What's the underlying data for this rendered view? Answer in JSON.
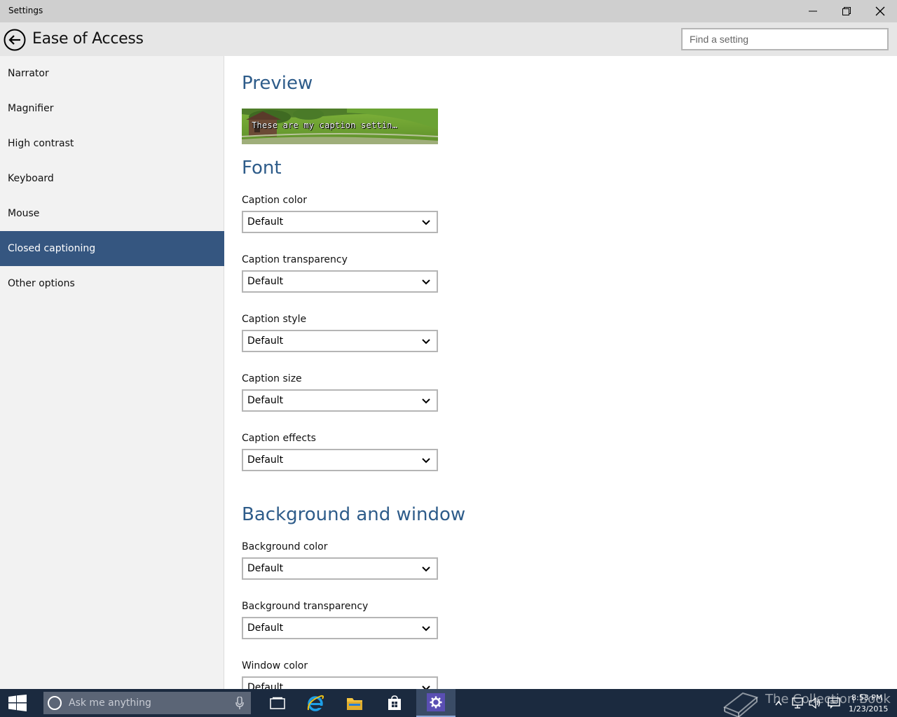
{
  "window": {
    "title": "Settings",
    "minimize_icon": "minimize-icon",
    "restore_icon": "restore-icon",
    "close_icon": "close-icon"
  },
  "header": {
    "back_icon": "back-arrow-icon",
    "title": "Ease of Access",
    "search_placeholder": "Find a setting"
  },
  "sidebar": {
    "items": [
      {
        "label": "Narrator"
      },
      {
        "label": "Magnifier"
      },
      {
        "label": "High contrast"
      },
      {
        "label": "Keyboard"
      },
      {
        "label": "Mouse"
      },
      {
        "label": "Closed captioning",
        "selected": true
      },
      {
        "label": "Other options"
      }
    ],
    "accent_color": "#355680"
  },
  "content": {
    "preview": {
      "title": "Preview",
      "caption_text": "These are my caption settin…"
    },
    "font": {
      "title": "Font",
      "fields": [
        {
          "label": "Caption color",
          "value": "Default"
        },
        {
          "label": "Caption transparency",
          "value": "Default"
        },
        {
          "label": "Caption style",
          "value": "Default"
        },
        {
          "label": "Caption size",
          "value": "Default"
        },
        {
          "label": "Caption effects",
          "value": "Default"
        }
      ]
    },
    "background": {
      "title": "Background and window",
      "fields": [
        {
          "label": "Background color",
          "value": "Default"
        },
        {
          "label": "Background transparency",
          "value": "Default"
        },
        {
          "label": "Window color",
          "value": "Default"
        }
      ]
    },
    "heading_color": "#2e5c8a"
  },
  "taskbar": {
    "search_text": "Ask me anything",
    "apps": [
      "task-view-icon",
      "internet-explorer-icon",
      "file-explorer-icon",
      "store-icon",
      "settings-icon"
    ],
    "watermark": "The Collection Book",
    "time": "8:53 PM",
    "date": "1/23/2015"
  }
}
